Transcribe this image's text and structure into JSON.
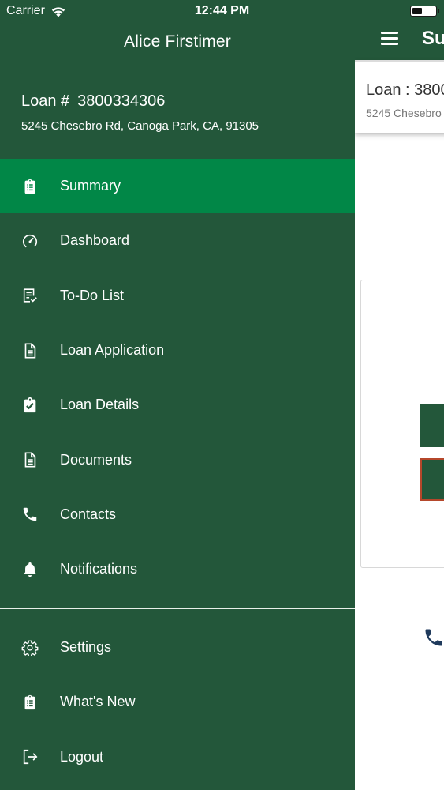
{
  "status_bar": {
    "carrier": "Carrier",
    "time": "12:44 PM"
  },
  "drawer": {
    "user_name": "Alice Firstimer",
    "loan_label": "Loan #",
    "loan_number": "3800334306",
    "address": "5245 Chesebro Rd, Canoga Park, CA, 91305",
    "menu": [
      {
        "label": "Summary",
        "icon": "clipboard-icon",
        "active": true
      },
      {
        "label": "Dashboard",
        "icon": "gauge-icon"
      },
      {
        "label": "To-Do List",
        "icon": "checklist-icon"
      },
      {
        "label": "Loan Application",
        "icon": "document-icon"
      },
      {
        "label": "Loan Details",
        "icon": "clipboard-check-icon"
      },
      {
        "label": "Documents",
        "icon": "document-icon"
      },
      {
        "label": "Contacts",
        "icon": "phone-icon"
      },
      {
        "label": "Notifications",
        "icon": "bell-icon"
      }
    ],
    "bottom_menu": [
      {
        "label": "Settings",
        "icon": "gear-icon"
      },
      {
        "label": "What's New",
        "icon": "clipboard-list-icon"
      },
      {
        "label": "Logout",
        "icon": "logout-icon"
      }
    ]
  },
  "main": {
    "title": "Su",
    "loan_card_title": "Loan : 3800",
    "loan_card_address": "5245 Chesebro"
  },
  "colors": {
    "drawer_bg": "#23573a",
    "active_bg": "#018747",
    "divider": "#e8efe9"
  }
}
